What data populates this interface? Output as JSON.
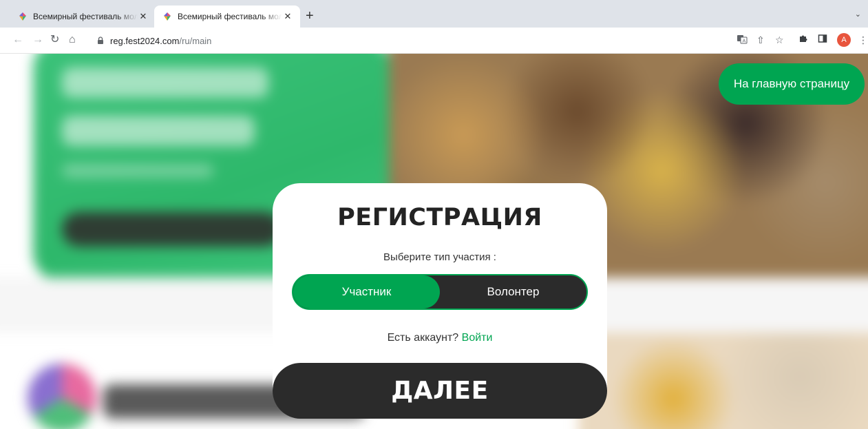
{
  "browser": {
    "tabs": [
      {
        "title": "Всемирный фестиваль молодежи",
        "active": false
      },
      {
        "title": "Всемирный фестиваль молодежи",
        "active": true
      }
    ],
    "new_tab_label": "+",
    "tab_close": "✕",
    "address": {
      "host": "reg.fest2024.com",
      "path": "/ru/main"
    },
    "profile_initial": "A",
    "accent_colors": {
      "profile": "#e8553d"
    }
  },
  "page": {
    "home_button": "На главную страницу",
    "brand_colors": {
      "green": "#00a551",
      "dark": "#2b2b2b"
    }
  },
  "registration": {
    "title": "РЕГИСТРАЦИЯ",
    "subtitle": "Выберите тип участия :",
    "options": [
      {
        "label": "Участник",
        "selected": true
      },
      {
        "label": "Волонтер",
        "selected": false
      }
    ],
    "account_prompt": "Есть аккаунт?",
    "login_link": "Войти",
    "next_button": "ДАЛЕЕ"
  }
}
